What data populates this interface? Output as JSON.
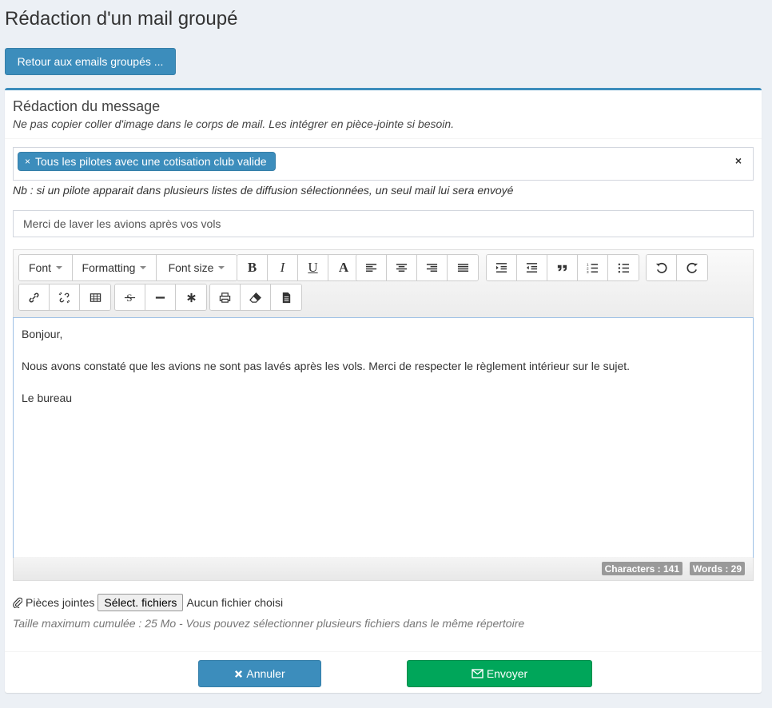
{
  "page": {
    "title": "Rédaction d'un mail groupé",
    "back_label": "Retour aux emails groupés ..."
  },
  "box": {
    "title": "Rédaction du message",
    "subtitle": "Ne pas copier coller d'image dans le corps de mail. Les intégrer en pièce-jointe si besoin."
  },
  "recipients": {
    "tags": [
      {
        "label": "Tous les pilotes avec une cotisation club valide"
      }
    ],
    "remove_glyph": "×",
    "clear_glyph": "×",
    "note": "Nb : si un pilote apparait dans plusieurs listes de diffusion sélectionnées, un seul mail lui sera envoyé"
  },
  "subject": {
    "value": "Merci de laver les avions après vos vols"
  },
  "editor": {
    "toolbar": {
      "font": "Font",
      "formatting": "Formatting",
      "font_size": "Font size",
      "bold": "B",
      "italic": "I",
      "underline": "U",
      "font_color": "A"
    },
    "content": [
      "Bonjour,",
      "",
      "Nous avons constaté que les avions ne sont pas lavés après les vols. Merci de respecter le règlement intérieur sur le sujet.",
      "",
      "Le bureau"
    ],
    "characters": "Characters : 141",
    "words": "Words : 29"
  },
  "attachments": {
    "label": "Pièces jointes",
    "button": "Sélect. fichiers",
    "status": "Aucun fichier choisi",
    "help": "Taille maximum cumulée : 25 Mo - Vous pouvez sélectionner plusieurs fichiers dans le même répertoire"
  },
  "footer": {
    "cancel_label": "Annuler",
    "send_label": "Envoyer"
  },
  "colors": {
    "primary": "#3c8dbc",
    "success": "#00a65a",
    "background": "#ecf0f5"
  }
}
